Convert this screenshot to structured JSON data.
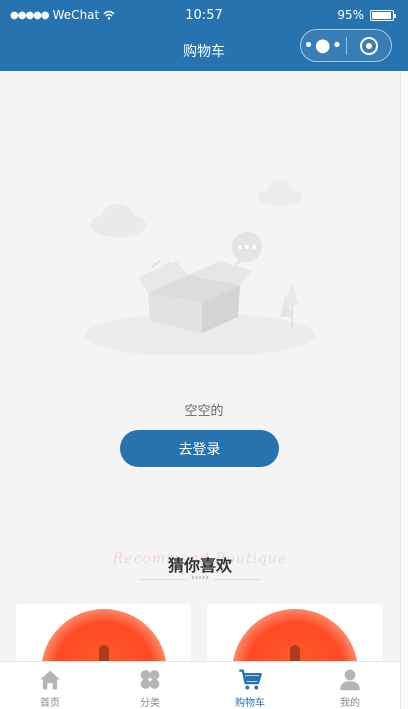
{
  "status_bar": {
    "dots": "●●●●●",
    "carrier": "WeChat",
    "wifi_icon": "wifi-icon",
    "time": "10:57",
    "battery_percent": "95%",
    "battery_level": 0.95
  },
  "navbar": {
    "title": "购物车",
    "capsule_more": "•●•",
    "capsule_close_icon": "target-icon",
    "accent_color": "#2673b0"
  },
  "empty_state": {
    "illustration_icon": "empty-box-icon",
    "text": "空空的",
    "login_button": "去登录"
  },
  "recommend": {
    "ghost_text": "Recommend Boutique",
    "title": "猜你喜欢",
    "arrows": "›››››"
  },
  "tabbar": {
    "items": [
      {
        "label": "首页",
        "icon": "home-icon"
      },
      {
        "label": "分类",
        "icon": "category-icon"
      },
      {
        "label": "购物车",
        "icon": "cart-icon",
        "active": true
      },
      {
        "label": "我的",
        "icon": "user-icon"
      }
    ],
    "active_color": "#2673b0",
    "inactive_color": "#b5b5b5"
  }
}
